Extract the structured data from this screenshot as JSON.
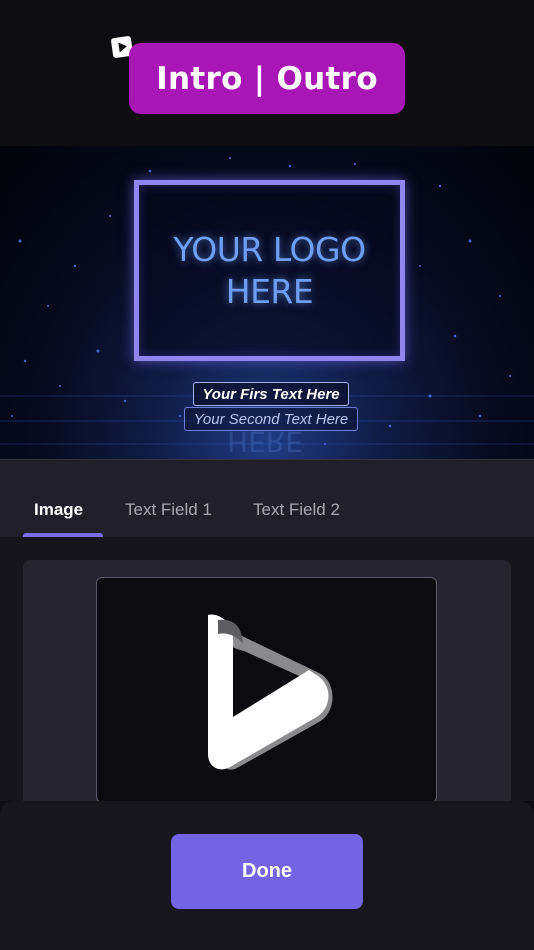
{
  "header": {
    "title": "Intro | Outro",
    "icon": "video-plus-icon"
  },
  "preview": {
    "logo_line1": "YOUR LOGO",
    "logo_line2": "HERE",
    "text_field_1": "Your Firs Text Here",
    "text_field_2": "Your Second Text Here"
  },
  "tabs": [
    {
      "label": "Image",
      "active": true
    },
    {
      "label": "Text Field 1",
      "active": false
    },
    {
      "label": "Text Field 2",
      "active": false
    }
  ],
  "image_panel": {
    "thumbnail_icon": "play-logo-icon"
  },
  "footer": {
    "done_label": "Done"
  },
  "colors": {
    "accent": "#7563e6",
    "title_pill": "#a816b5",
    "background": "#0e0d12"
  }
}
